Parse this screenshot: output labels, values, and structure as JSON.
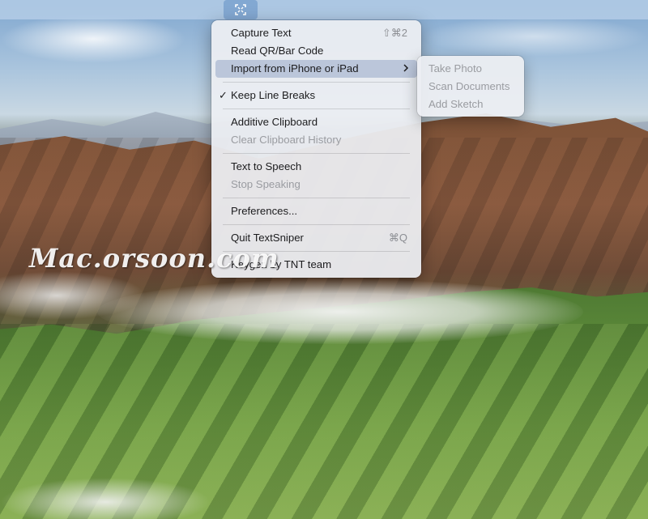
{
  "menubar": {
    "app_icon": "textsniper-capture-icon"
  },
  "menu": {
    "items": [
      {
        "label": "Capture Text",
        "shortcut": "⇧⌘2"
      },
      {
        "label": "Read QR/Bar Code"
      },
      {
        "label": "Import from iPhone or iPad",
        "submenu_indicator": "›"
      },
      {
        "label": "Keep Line Breaks",
        "checked": "✓"
      },
      {
        "label": "Additive Clipboard"
      },
      {
        "label": "Clear Clipboard History"
      },
      {
        "label": "Text to Speech"
      },
      {
        "label": "Stop Speaking"
      },
      {
        "label": "Preferences..."
      },
      {
        "label": "Quit TextSniper",
        "shortcut": "⌘Q"
      },
      {
        "label": "Keygen by TNT team"
      }
    ]
  },
  "submenu": {
    "items": [
      {
        "label": "Take Photo"
      },
      {
        "label": "Scan Documents"
      },
      {
        "label": "Add Sketch"
      }
    ]
  },
  "watermark": {
    "text": "Mac.orsoon.com"
  }
}
